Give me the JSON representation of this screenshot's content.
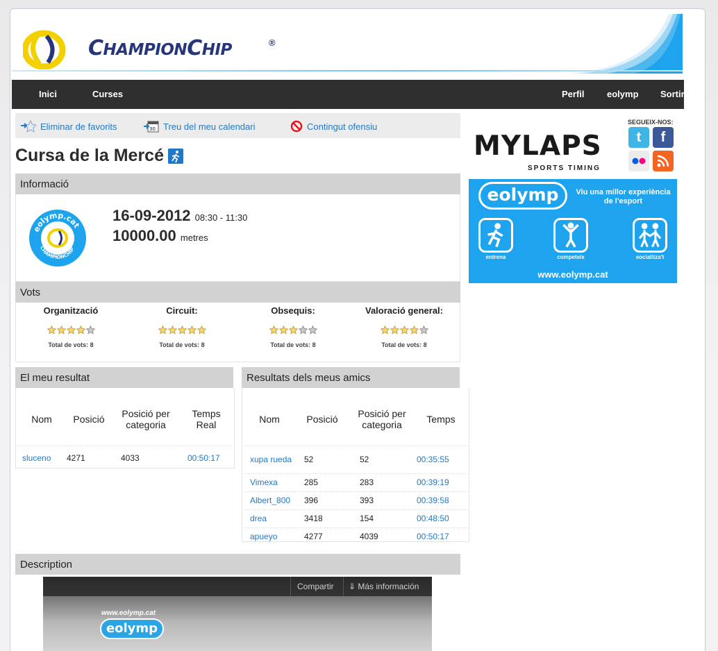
{
  "brand": {
    "name_big_c": "C",
    "name_rest1": "HAMPION",
    "name_big_c2": "C",
    "name_rest2": "HIP",
    "registered": "®"
  },
  "nav": {
    "left": [
      "Inici",
      "Curses"
    ],
    "right": [
      "Perfil",
      "eolymp",
      "Sortir"
    ]
  },
  "toolbar": {
    "favorites": "Eliminar de favorits",
    "calendar": "Treu del meu calendari",
    "calendar_badge": "30",
    "offensive": "Contingut ofensiu"
  },
  "race": {
    "title": "Cursa de la Mercé",
    "date": "16-09-2012",
    "time": "08:30 - 11:30",
    "distance": "10000.00",
    "distance_unit": "metres",
    "logo_top": "eolymp.cat",
    "logo_bottom": "CHAMPIONCHIP"
  },
  "sections": {
    "info": "Informació",
    "votes": "Vots",
    "my_result": "El meu resultat",
    "friends": "Resultats dels meus amics",
    "description": "Description"
  },
  "votes": [
    {
      "title": "Organització",
      "stars": 4,
      "total": "Total de vots: 8"
    },
    {
      "title": "Circuit:",
      "stars": 5,
      "total": "Total de vots: 8"
    },
    {
      "title": "Obsequis:",
      "stars": 3,
      "total": "Total de vots: 8"
    },
    {
      "title": "Valoració general:",
      "stars": 4,
      "total": "Total de vots: 8"
    }
  ],
  "my_result": {
    "headers": [
      "Nom",
      "Posició",
      "Posició per categoria",
      "Temps Real"
    ],
    "rows": [
      [
        "sluceno",
        "4271",
        "4033",
        "00:50:17"
      ]
    ]
  },
  "friends": {
    "headers": [
      "Nom",
      "Posició",
      "Posició per categoria",
      "Temps"
    ],
    "rows": [
      [
        "xupa rueda",
        "52",
        "52",
        "00:35:55"
      ],
      [
        "Vimexa",
        "285",
        "283",
        "00:39:19"
      ],
      [
        "Albert_800",
        "396",
        "393",
        "00:39:58"
      ],
      [
        "drea",
        "3418",
        "154",
        "00:48:50"
      ],
      [
        "apueyo",
        "4277",
        "4039",
        "00:50:17"
      ]
    ]
  },
  "sidebar": {
    "mylaps": "MYLAPS",
    "mylaps_sub": "SPORTS TIMING",
    "follow": "SEGUEIX-NOS:",
    "ad": {
      "logo": "eolymp",
      "tagline": "Viu una millor experiència de l'esport",
      "items": [
        "entrena",
        "competeix",
        "socialitza't"
      ],
      "url": "www.eolymp.cat"
    }
  },
  "video": {
    "share": "Compartir",
    "more": "Más información",
    "url": "www.eolymp.cat",
    "logo": "eolymp"
  },
  "colors": {
    "link": "#1f78c9",
    "nav": "#2f2f2f",
    "section": "#d2d2d2",
    "ad": "#1ea4ee",
    "brand": "#27357a"
  }
}
